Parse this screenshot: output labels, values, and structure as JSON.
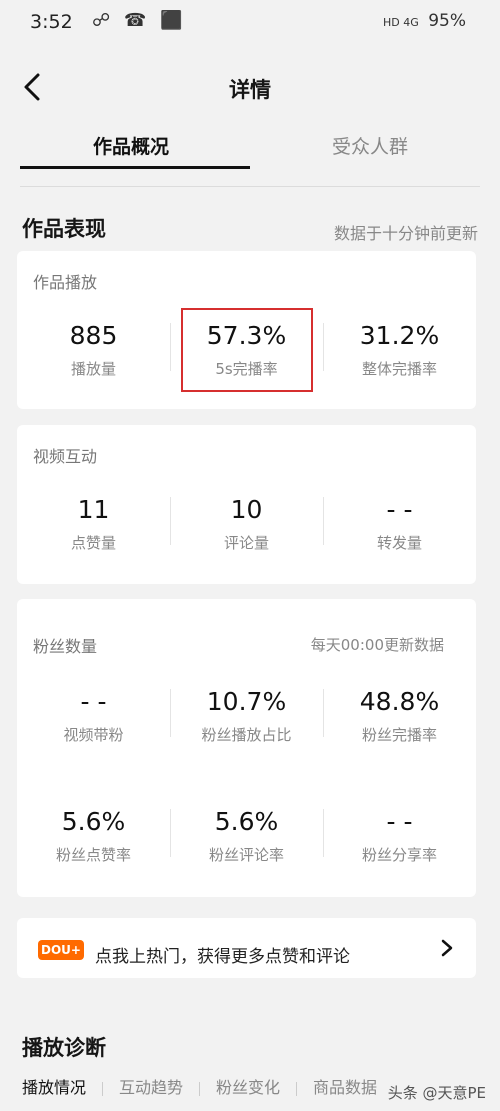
{
  "status_bar": {
    "time": "3:52",
    "left_icons": "☍ ☎ ⬛",
    "battery": "95%",
    "signal_hd": "HD 4G"
  },
  "header": {
    "title": "详情"
  },
  "tabs": [
    {
      "label": "作品概况"
    },
    {
      "label": "受众人群"
    }
  ],
  "performance": {
    "title": "作品表现",
    "note": "数据于十分钟前更新",
    "play": {
      "title": "作品播放",
      "metrics": [
        {
          "value": "885",
          "label": "播放量"
        },
        {
          "value": "57.3%",
          "label": "5s完播率"
        },
        {
          "value": "31.2%",
          "label": "整体完播率"
        }
      ]
    },
    "interaction": {
      "title": "视频互动",
      "metrics": [
        {
          "value": "11",
          "label": "点赞量"
        },
        {
          "value": "10",
          "label": "评论量"
        },
        {
          "value": "- -",
          "label": "转发量"
        }
      ]
    },
    "fans": {
      "title": "粉丝数量",
      "note": "每天00:00更新数据",
      "metrics": [
        {
          "value": "- -",
          "label": "视频带粉"
        },
        {
          "value": "10.7%",
          "label": "粉丝播放占比"
        },
        {
          "value": "48.8%",
          "label": "粉丝完播率"
        },
        {
          "value": "5.6%",
          "label": "粉丝点赞率"
        },
        {
          "value": "5.6%",
          "label": "粉丝评论率"
        },
        {
          "value": "- -",
          "label": "粉丝分享率"
        }
      ]
    }
  },
  "promo": {
    "badge": "DOU+",
    "text": "点我上热门，获得更多点赞和评论"
  },
  "diagnosis": {
    "title": "播放诊断",
    "subtabs": [
      {
        "label": "播放情况"
      },
      {
        "label": "互动趋势"
      },
      {
        "label": "粉丝变化"
      },
      {
        "label": "商品数据"
      }
    ]
  },
  "watermark": "头条 @天意PE",
  "colors": {
    "accent_red": "#d62f2f",
    "dou_orange": "#ff6a00"
  }
}
